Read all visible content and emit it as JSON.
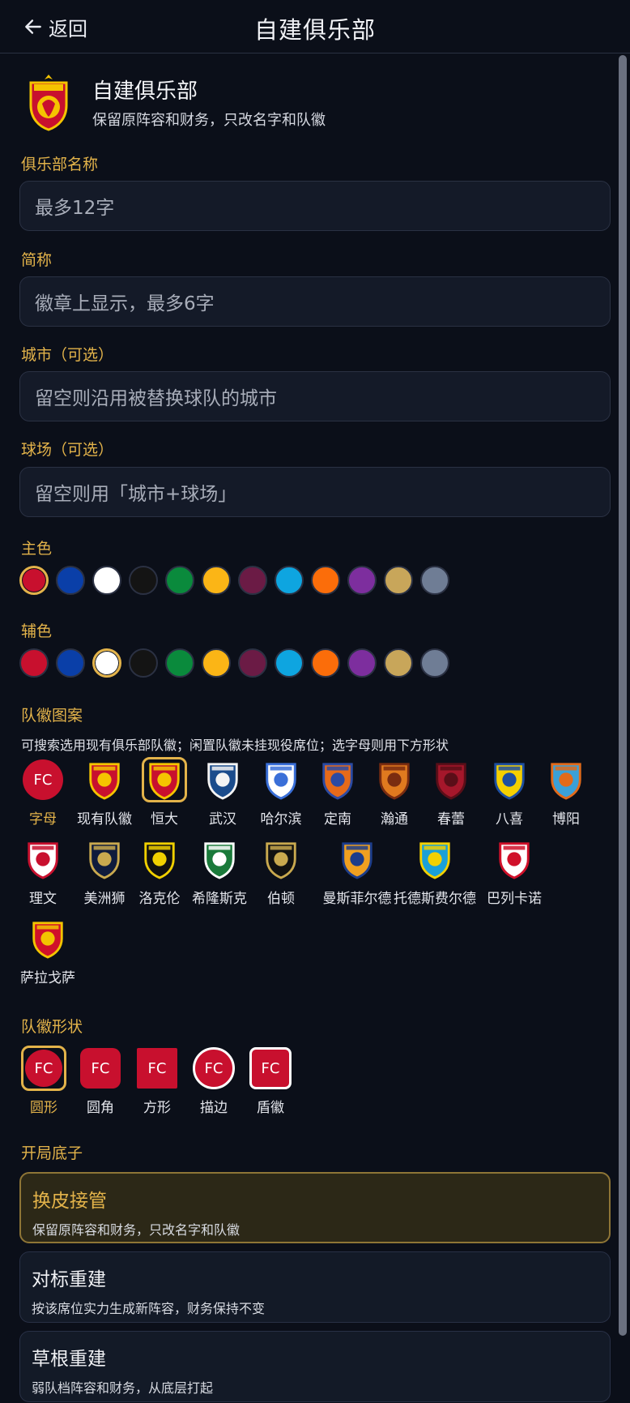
{
  "header": {
    "back_label": "返回",
    "title": "自建俱乐部"
  },
  "intro": {
    "title": "自建俱乐部",
    "subtitle": "保留原阵容和财务，只改名字和队徽"
  },
  "fields": [
    {
      "label": "俱乐部名称",
      "placeholder": "最多12字",
      "value": ""
    },
    {
      "label": "简称",
      "placeholder": "徽章上显示，最多6字",
      "value": ""
    },
    {
      "label": "城市（可选）",
      "placeholder": "留空则沿用被替换球队的城市",
      "value": ""
    },
    {
      "label": "球场（可选）",
      "placeholder": "留空则用「城市+球场」",
      "value": ""
    }
  ],
  "primary_color": {
    "label": "主色",
    "selected_index": 0,
    "colors": [
      "#c8102e",
      "#0a3fa8",
      "#ffffff",
      "#141414",
      "#0a8a3c",
      "#fbb516",
      "#6b1b45",
      "#0ea5e0",
      "#fb6d0a",
      "#7d2e9e",
      "#c8a65a",
      "#6f7d95"
    ]
  },
  "secondary_color": {
    "label": "辅色",
    "selected_index": 2,
    "colors": [
      "#c8102e",
      "#0a3fa8",
      "#ffffff",
      "#141414",
      "#0a8a3c",
      "#fbb516",
      "#6b1b45",
      "#0ea5e0",
      "#fb6d0a",
      "#7d2e9e",
      "#c8a65a",
      "#6f7d95"
    ]
  },
  "emblem": {
    "label": "队徽图案",
    "hint": "可搜索选用现有俱乐部队徽；闲置队徽未挂现役席位；选字母则用下方形状",
    "letter_text": "FC",
    "items": [
      {
        "name": "字母",
        "icon": "letter-badge-icon"
      },
      {
        "name": "现有队徽",
        "icon": "existing-crest-icon"
      },
      {
        "name": "恒大",
        "icon": "hengda-crest-icon"
      },
      {
        "name": "武汉",
        "icon": "wuhan-crest-icon"
      },
      {
        "name": "哈尔滨",
        "icon": "harbin-crest-icon"
      },
      {
        "name": "定南",
        "icon": "dingnan-crest-icon"
      },
      {
        "name": "瀚通",
        "icon": "hantong-crest-icon"
      },
      {
        "name": "春蕾",
        "icon": "chunlei-crest-icon"
      },
      {
        "name": "八喜",
        "icon": "baxi-crest-icon"
      },
      {
        "name": "博阳",
        "icon": "boyang-crest-icon"
      },
      {
        "name": "理文",
        "icon": "liwen-crest-icon"
      },
      {
        "name": "美洲狮",
        "icon": "pumas-crest-icon"
      },
      {
        "name": "洛克伦",
        "icon": "lokeren-crest-icon"
      },
      {
        "name": "希隆斯克",
        "icon": "slask-crest-icon"
      },
      {
        "name": "伯顿",
        "icon": "burton-crest-icon"
      },
      {
        "name": "曼斯菲尔德",
        "icon": "mansfield-crest-icon"
      },
      {
        "name": "托德斯费尔德",
        "icon": "todesfelde-crest-icon"
      },
      {
        "name": "巴列卡诺",
        "icon": "rayo-crest-icon"
      },
      {
        "name": "萨拉戈萨",
        "icon": "zaragoza-crest-icon"
      }
    ],
    "selected_index": 2
  },
  "shape": {
    "label": "队徽形状",
    "text": "FC",
    "items": [
      "圆形",
      "圆角",
      "方形",
      "描边",
      "盾徽"
    ],
    "selected_index": 0
  },
  "start": {
    "label": "开局底子",
    "options": [
      {
        "title": "换皮接管",
        "desc": "保留原阵容和财务，只改名字和队徽"
      },
      {
        "title": "对标重建",
        "desc": "按该席位实力生成新阵容，财务保持不变"
      },
      {
        "title": "草根重建",
        "desc": "弱队档阵容和财务，从底层打起"
      }
    ],
    "selected_index": 0
  }
}
